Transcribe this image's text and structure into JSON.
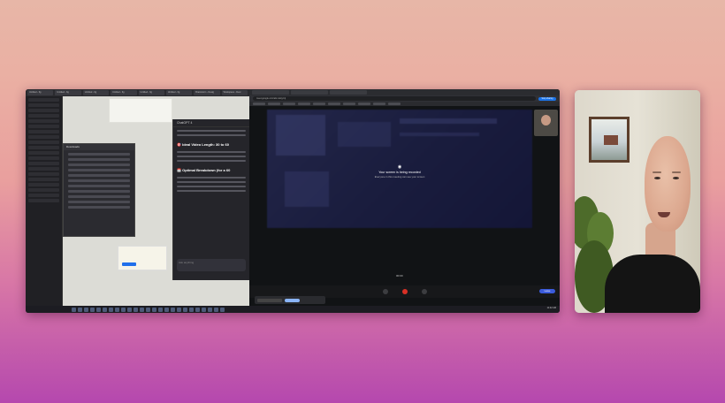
{
  "desktop": {
    "left_app": {
      "tabs": [
        "Untitled - fig",
        "Untitled - fig",
        "Untitled - fig",
        "Untitled - fig",
        "Untitled - fig",
        "Untitled - fig",
        "Brainstorm - Desig",
        "Workspace - Desi"
      ],
      "chat_title": "ChatGPT 4",
      "chat_heading_1": "🎯 Ideal Video Length: 30 to 60",
      "chat_heading_2": "📅 Optimal Breakdown (for a 60",
      "chat_input_placeholder": "Ask anything",
      "explorer_title": "Downloads"
    },
    "browser": {
      "url": "meet.google.com/abc-defg-hij",
      "stop_share": "Stop sharing",
      "recording_title": "Your screen is being recorded",
      "recording_sub": "Everyone in this meeting can see your screen",
      "timer": "00:00",
      "leave_label": "Leave",
      "notification": "meet.google.com is sharing your screen",
      "notif_button": "Hide"
    },
    "clock": "11:42 AM"
  },
  "colors": {
    "stop_share": "#1a73e8",
    "record": "#d93025",
    "leave": "#3b5bdb"
  }
}
